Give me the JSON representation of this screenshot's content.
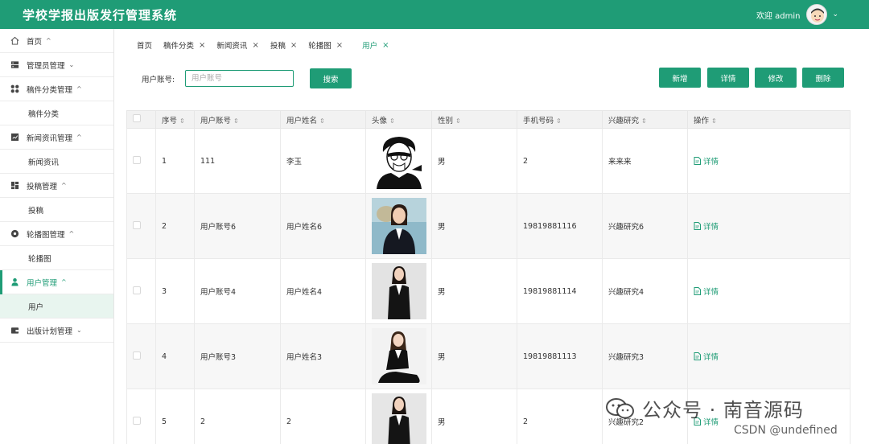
{
  "header": {
    "title": "学校学报出版发行管理系统",
    "welcome": "欢迎 admin"
  },
  "sidebar": {
    "items": [
      {
        "label": "首页",
        "icon": "home-icon",
        "chevron": "^"
      },
      {
        "label": "管理员管理",
        "icon": "server-icon",
        "chevron": "v"
      },
      {
        "label": "稿件分类管理",
        "icon": "grid-dots-icon",
        "chevron": "^",
        "sub": "稿件分类"
      },
      {
        "label": "新闻资讯管理",
        "icon": "chart-box-icon",
        "chevron": "^",
        "sub": "新闻资讯"
      },
      {
        "label": "投稿管理",
        "icon": "dashboard-icon",
        "chevron": "^",
        "sub": "投稿"
      },
      {
        "label": "轮播图管理",
        "icon": "circle-dot-icon",
        "chevron": "^",
        "sub": "轮播图"
      },
      {
        "label": "用户管理",
        "icon": "user-icon",
        "chevron": "^",
        "sub": "用户"
      },
      {
        "label": "出版计划管理",
        "icon": "wallet-icon",
        "chevron": "v"
      }
    ]
  },
  "tabs": [
    {
      "label": "首页",
      "closable": false
    },
    {
      "label": "稿件分类",
      "closable": true
    },
    {
      "label": "新闻资讯",
      "closable": true
    },
    {
      "label": "投稿",
      "closable": true
    },
    {
      "label": "轮播图",
      "closable": true
    },
    {
      "label": "用户",
      "closable": true,
      "active": true
    }
  ],
  "search": {
    "label": "用户账号:",
    "placeholder": "用户账号",
    "button": "搜索"
  },
  "actions": {
    "add": "新增",
    "detail": "详情",
    "edit": "修改",
    "delete": "删除"
  },
  "table": {
    "columns": [
      "序号",
      "用户账号",
      "用户姓名",
      "头像",
      "性别",
      "手机号码",
      "兴趣研究",
      "操作"
    ],
    "detail_label": "详情",
    "rows": [
      {
        "no": "1",
        "account": "111",
        "name": "李玉",
        "avatar": "sketch-portrait",
        "gender": "男",
        "phone": "2",
        "interest": "来来来"
      },
      {
        "no": "2",
        "account": "用户账号6",
        "name": "用户姓名6",
        "avatar": "photo-woman-outdoor",
        "gender": "男",
        "phone": "19819881116",
        "interest": "兴趣研究6"
      },
      {
        "no": "3",
        "account": "用户账号4",
        "name": "用户姓名4",
        "avatar": "photo-woman-suit",
        "gender": "男",
        "phone": "19819881114",
        "interest": "兴趣研究4"
      },
      {
        "no": "4",
        "account": "用户账号3",
        "name": "用户姓名3",
        "avatar": "photo-woman-sitting",
        "gender": "男",
        "phone": "19819881113",
        "interest": "兴趣研究3"
      },
      {
        "no": "5",
        "account": "2",
        "name": "2",
        "avatar": "photo-woman-suit",
        "gender": "男",
        "phone": "2",
        "interest": "兴趣研究2"
      }
    ]
  },
  "watermark": {
    "line1": "公众号 · 南音源码",
    "line2": "CSDN @undefined"
  },
  "colors": {
    "primary": "#1f9c76"
  }
}
